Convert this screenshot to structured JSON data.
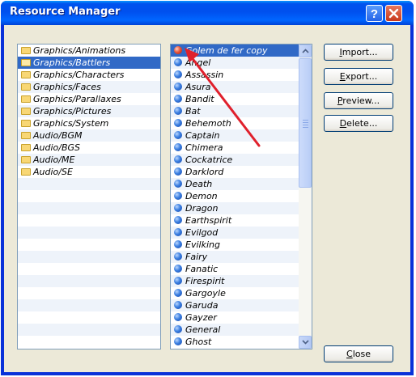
{
  "window": {
    "title": "Resource Manager"
  },
  "folders": [
    {
      "label": "Graphics/Animations"
    },
    {
      "label": "Graphics/Battlers"
    },
    {
      "label": "Graphics/Characters"
    },
    {
      "label": "Graphics/Faces"
    },
    {
      "label": "Graphics/Parallaxes"
    },
    {
      "label": "Graphics/Pictures"
    },
    {
      "label": "Graphics/System"
    },
    {
      "label": "Audio/BGM"
    },
    {
      "label": "Audio/BGS"
    },
    {
      "label": "Audio/ME"
    },
    {
      "label": "Audio/SE"
    }
  ],
  "selected_folder": "Graphics/Battlers",
  "files": [
    {
      "label": "Golem de fer copy",
      "icon": "red-ball-icon"
    },
    {
      "label": "Angel",
      "icon": "blue-ball-icon"
    },
    {
      "label": "Assassin",
      "icon": "blue-ball-icon"
    },
    {
      "label": "Asura",
      "icon": "blue-ball-icon"
    },
    {
      "label": "Bandit",
      "icon": "blue-ball-icon"
    },
    {
      "label": "Bat",
      "icon": "blue-ball-icon"
    },
    {
      "label": "Behemoth",
      "icon": "blue-ball-icon"
    },
    {
      "label": "Captain",
      "icon": "blue-ball-icon"
    },
    {
      "label": "Chimera",
      "icon": "blue-ball-icon"
    },
    {
      "label": "Cockatrice",
      "icon": "blue-ball-icon"
    },
    {
      "label": "Darklord",
      "icon": "blue-ball-icon"
    },
    {
      "label": "Death",
      "icon": "blue-ball-icon"
    },
    {
      "label": "Demon",
      "icon": "blue-ball-icon"
    },
    {
      "label": "Dragon",
      "icon": "blue-ball-icon"
    },
    {
      "label": "Earthspirit",
      "icon": "blue-ball-icon"
    },
    {
      "label": "Evilgod",
      "icon": "blue-ball-icon"
    },
    {
      "label": "Evilking",
      "icon": "blue-ball-icon"
    },
    {
      "label": "Fairy",
      "icon": "blue-ball-icon"
    },
    {
      "label": "Fanatic",
      "icon": "blue-ball-icon"
    },
    {
      "label": "Firespirit",
      "icon": "blue-ball-icon"
    },
    {
      "label": "Gargoyle",
      "icon": "blue-ball-icon"
    },
    {
      "label": "Garuda",
      "icon": "blue-ball-icon"
    },
    {
      "label": "Gayzer",
      "icon": "blue-ball-icon"
    },
    {
      "label": "General",
      "icon": "blue-ball-icon"
    },
    {
      "label": "Ghost",
      "icon": "blue-ball-icon"
    }
  ],
  "selected_file": "Golem de fer copy",
  "buttons": {
    "import": {
      "pre": "",
      "key": "I",
      "post": "mport..."
    },
    "export": {
      "pre": "",
      "key": "E",
      "post": "xport..."
    },
    "preview": {
      "pre": "",
      "key": "P",
      "post": "review..."
    },
    "delete": {
      "pre": "",
      "key": "D",
      "post": "elete..."
    },
    "close": {
      "pre": "",
      "key": "C",
      "post": "lose"
    }
  },
  "colors": {
    "titlebar": "#0053ee",
    "selection": "#3169c6",
    "annotation_arrow": "#e0202c"
  }
}
